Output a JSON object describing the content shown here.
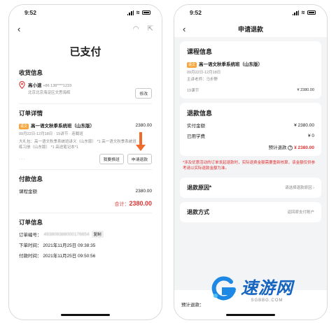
{
  "left": {
    "time": "9:52",
    "status_title": "已支付",
    "shipping": {
      "section_title": "收货信息",
      "name": "高小速",
      "phone": "+86 138****1233",
      "address": "北京北京海淀区文思海辉",
      "modify_label": "修改"
    },
    "order": {
      "section_title": "订单详情",
      "tag": "语文",
      "course": "高一语文秋季系统班（山东版）",
      "price": "2380.00",
      "meta": "09月22日-12月18日 · 15讲节 · 连载班",
      "items_line1": "大礼包：高一语文秋季系统班讲义（山东版） *1 高一语文秋季系统班",
      "items_line2": "练习册（山东版） *1 高途笔记本*1",
      "more": "· · ·",
      "swap_label": "我要换班",
      "refund_label": "申请退款"
    },
    "payment": {
      "section_title": "付款信息",
      "amount_label": "课程金额",
      "amount_value": "2380.00",
      "total_label": "合计：",
      "total_value": "2380.00"
    },
    "info": {
      "section_title": "订单信息",
      "order_no_label": "订单编号：",
      "order_no_value": "493809388000176654",
      "copy_label": "复制",
      "order_time_label": "下单时间：",
      "order_time_value": "2021年11月25日 09:38:35",
      "pay_time_label": "付款时间：",
      "pay_time_value": "2021年11月25日 09:50:56"
    }
  },
  "right": {
    "time": "9:52",
    "nav_title": "申请退款",
    "course_card": {
      "title": "课程信息",
      "tag": "语文",
      "course": "高一语文秋季系统班（山东版）",
      "dates": "09月22日-12月18日",
      "teacher": "主讲老师：马步野",
      "lessons": "19课节",
      "price": "¥ 2380.00"
    },
    "refund_card": {
      "title": "退款信息",
      "paid_label": "实付金额",
      "paid_value": "¥ 2380.00",
      "used_label": "已用学费",
      "used_value": "¥ 0",
      "estimate_label": "预计退款",
      "estimate_value": "¥ 2380.00",
      "note": "*涉及优惠活动的订单发起退款时，实际退费金额需要重新核算，该金额仅供参考请以实际退款金额为准。"
    },
    "reason": {
      "label": "退款原因*",
      "placeholder": "请选择退款原因"
    },
    "method": {
      "label": "退款方式",
      "value": "返回原支付账户"
    },
    "bottom": {
      "estimate_label": "预计退款："
    }
  },
  "watermark": {
    "text": "速游网",
    "domain": "SGBBG.COM"
  },
  "colors": {
    "accent_red": "#e03131",
    "arrow": "#f06b2a",
    "tag": "#f7a63a",
    "watermark": "#1565c0"
  }
}
